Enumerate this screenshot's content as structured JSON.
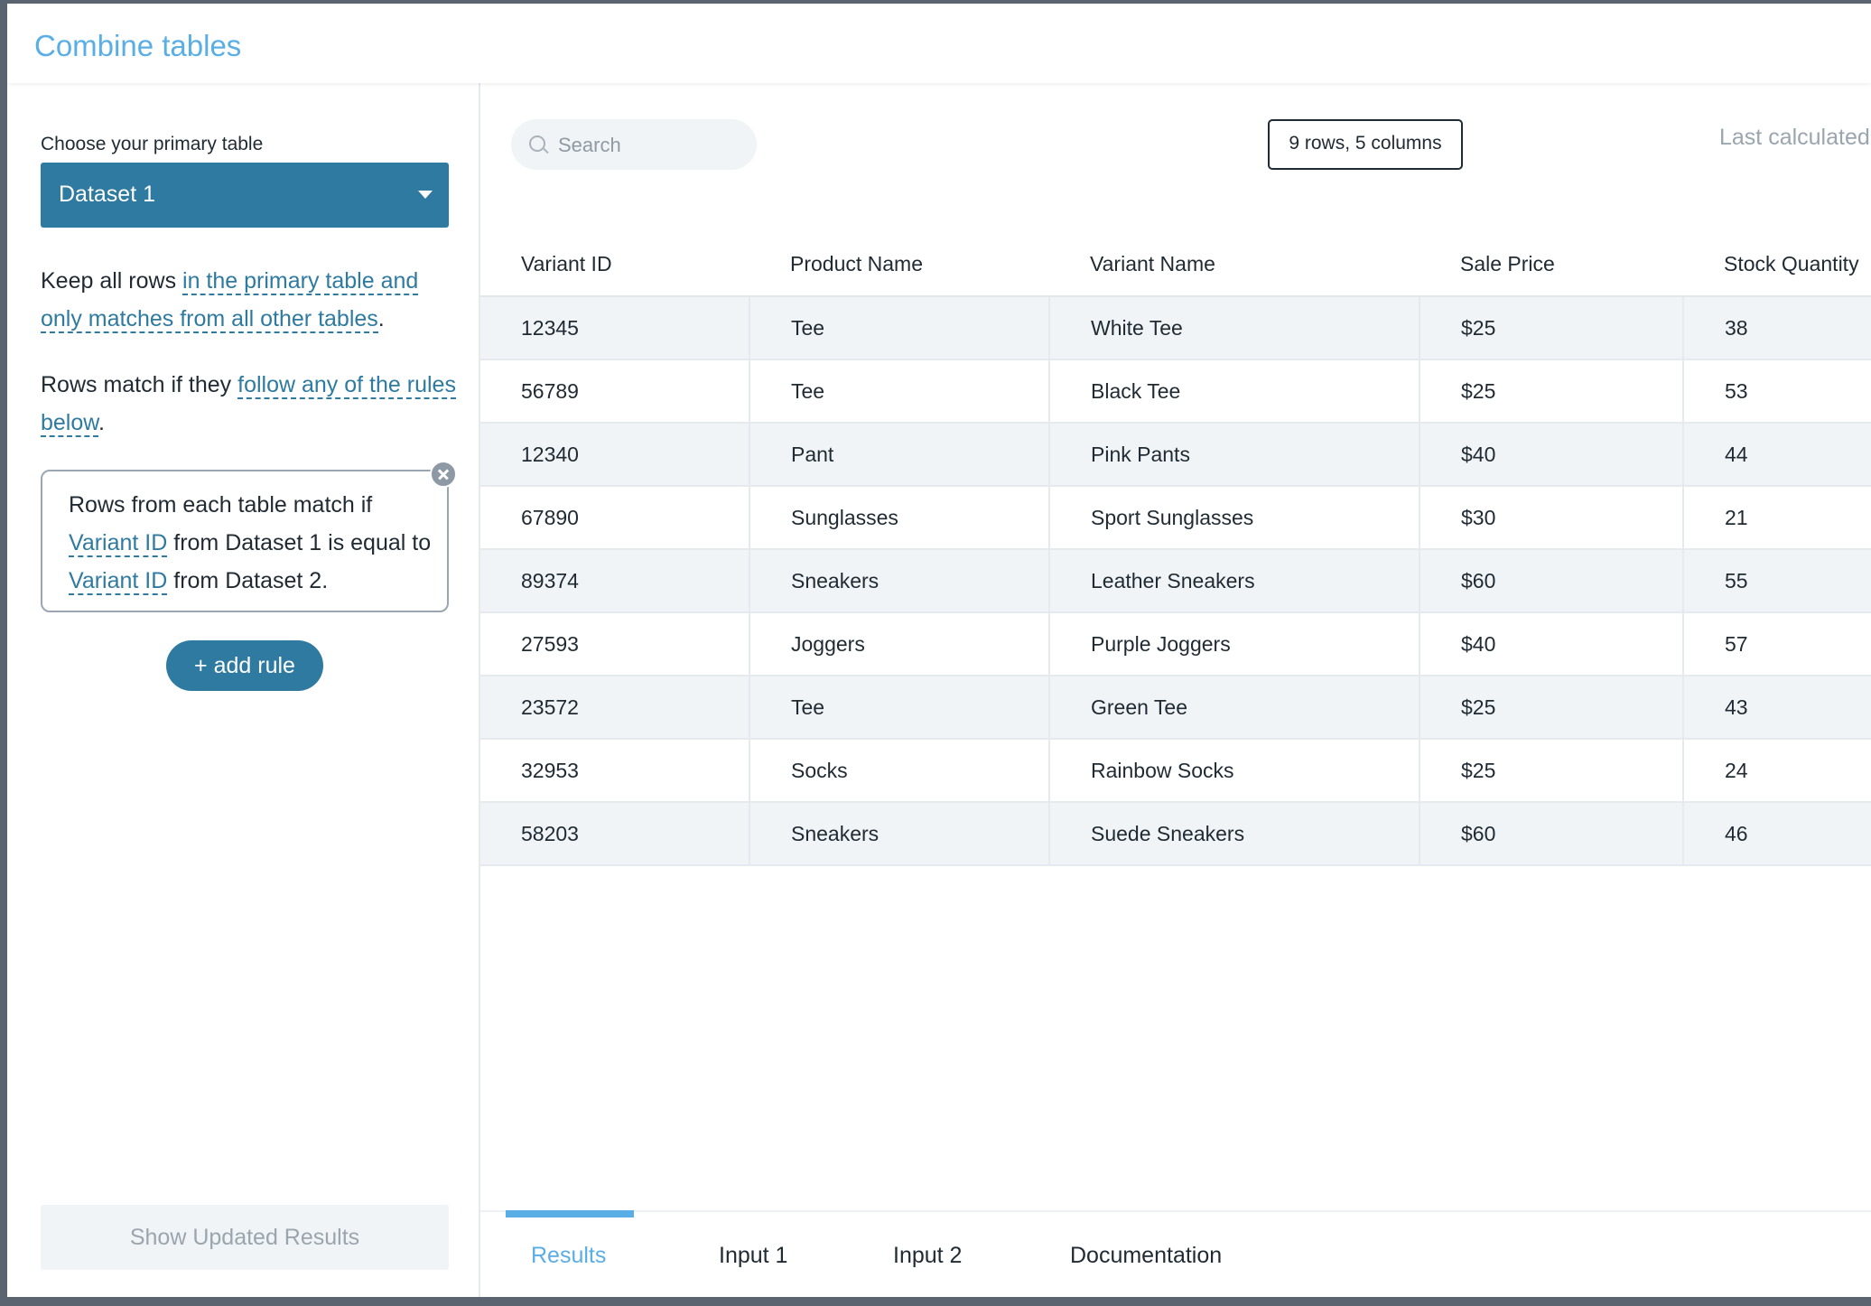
{
  "title": "Combine tables",
  "sidebar": {
    "primary_label": "Choose your primary table",
    "primary_value": "Dataset 1",
    "keep_prefix": "Keep all rows ",
    "keep_link": "in the primary table and only matches from all other tables",
    "keep_suffix": ".",
    "match_prefix": "Rows match if they ",
    "match_link": "follow any of the rules below",
    "match_suffix": ".",
    "rule": {
      "t1": "Rows from each table match if ",
      "field1": "Variant ID",
      "t2": " from Dataset 1 is equal to ",
      "field2": "Variant ID",
      "t3": " from Dataset 2."
    },
    "add_rule_label": "+ add rule",
    "show_results_label": "Show Updated Results"
  },
  "toolbar": {
    "search_placeholder": "Search",
    "row_count": "9 rows, 5 columns",
    "last_calculated": "Last calculated"
  },
  "table": {
    "columns": [
      "Variant ID",
      "Product Name",
      "Variant Name",
      "Sale Price",
      "Stock Quantity"
    ],
    "rows": [
      [
        "12345",
        "Tee",
        "White Tee",
        "$25",
        "38"
      ],
      [
        "56789",
        "Tee",
        "Black Tee",
        "$25",
        "53"
      ],
      [
        "12340",
        "Pant",
        "Pink Pants",
        "$40",
        "44"
      ],
      [
        "67890",
        "Sunglasses",
        "Sport Sunglasses",
        "$30",
        "21"
      ],
      [
        "89374",
        "Sneakers",
        "Leather Sneakers",
        "$60",
        "55"
      ],
      [
        "27593",
        "Joggers",
        "Purple Joggers",
        "$40",
        "57"
      ],
      [
        "23572",
        "Tee",
        "Green Tee",
        "$25",
        "43"
      ],
      [
        "32953",
        "Socks",
        "Rainbow Socks",
        "$25",
        "24"
      ],
      [
        "58203",
        "Sneakers",
        "Suede Sneakers",
        "$60",
        "46"
      ]
    ]
  },
  "tabs": [
    {
      "label": "Results",
      "active": true
    },
    {
      "label": "Input 1",
      "active": false
    },
    {
      "label": "Input 2",
      "active": false
    },
    {
      "label": "Documentation",
      "active": false
    }
  ],
  "colors": {
    "accent": "#5aaee6",
    "primary": "#2e7aa0"
  }
}
